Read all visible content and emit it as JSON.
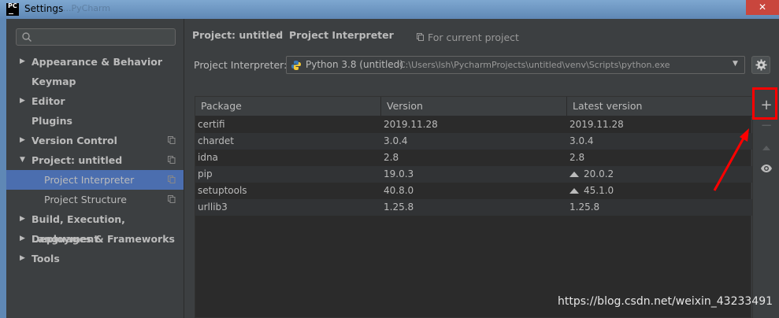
{
  "window": {
    "icon_text": "PC",
    "title": "Settings",
    "background_title": "...PyCharm",
    "close_glyph": "✕"
  },
  "sidebar": {
    "search_placeholder": "",
    "items": [
      {
        "label": "Appearance & Behavior",
        "arrow": "▶",
        "level": 0,
        "selected": false,
        "copy": false
      },
      {
        "label": "Keymap",
        "arrow": "",
        "level": 0,
        "selected": false,
        "copy": false
      },
      {
        "label": "Editor",
        "arrow": "▶",
        "level": 0,
        "selected": false,
        "copy": false
      },
      {
        "label": "Plugins",
        "arrow": "",
        "level": 0,
        "selected": false,
        "copy": false
      },
      {
        "label": "Version Control",
        "arrow": "▶",
        "level": 0,
        "selected": false,
        "copy": true
      },
      {
        "label": "Project: untitled",
        "arrow": "▼",
        "level": 0,
        "selected": false,
        "copy": true
      },
      {
        "label": "Project Interpreter",
        "arrow": "",
        "level": 1,
        "selected": true,
        "copy": true
      },
      {
        "label": "Project Structure",
        "arrow": "",
        "level": 1,
        "selected": false,
        "copy": true
      },
      {
        "label": "Build, Execution, Deployment",
        "arrow": "▶",
        "level": 0,
        "selected": false,
        "copy": false
      },
      {
        "label": "Languages & Frameworks",
        "arrow": "▶",
        "level": 0,
        "selected": false,
        "copy": false
      },
      {
        "label": "Tools",
        "arrow": "▶",
        "level": 0,
        "selected": false,
        "copy": false
      }
    ]
  },
  "breadcrumb": {
    "project": "Project: untitled",
    "separator": "›",
    "page": "Project Interpreter",
    "scope": "For current project"
  },
  "interpreter": {
    "label": "Project Interpreter:",
    "name": "Python 3.8 (untitled)",
    "path": "C:\\Users\\lsh\\PycharmProjects\\untitled\\venv\\Scripts\\python.exe",
    "chevron": "▼"
  },
  "packages": {
    "columns": [
      "Package",
      "Version",
      "Latest version"
    ],
    "rows": [
      {
        "package": "certifi",
        "version": "2019.11.28",
        "latest": "2019.11.28",
        "upgrade": false
      },
      {
        "package": "chardet",
        "version": "3.0.4",
        "latest": "3.0.4",
        "upgrade": false
      },
      {
        "package": "idna",
        "version": "2.8",
        "latest": "2.8",
        "upgrade": false
      },
      {
        "package": "pip",
        "version": "19.0.3",
        "latest": "20.0.2",
        "upgrade": true
      },
      {
        "package": "setuptools",
        "version": "40.8.0",
        "latest": "45.1.0",
        "upgrade": true
      },
      {
        "package": "urllib3",
        "version": "1.25.8",
        "latest": "1.25.8",
        "upgrade": false
      }
    ]
  },
  "toolbar": {
    "add": "+",
    "remove": "−"
  },
  "watermark": "https://blog.csdn.net/weixin_43233491",
  "colors": {
    "background": "#3c3f41",
    "table_background": "#2b2b2b",
    "selection": "#4b6eaf",
    "annotation_red": "#ff0000"
  }
}
